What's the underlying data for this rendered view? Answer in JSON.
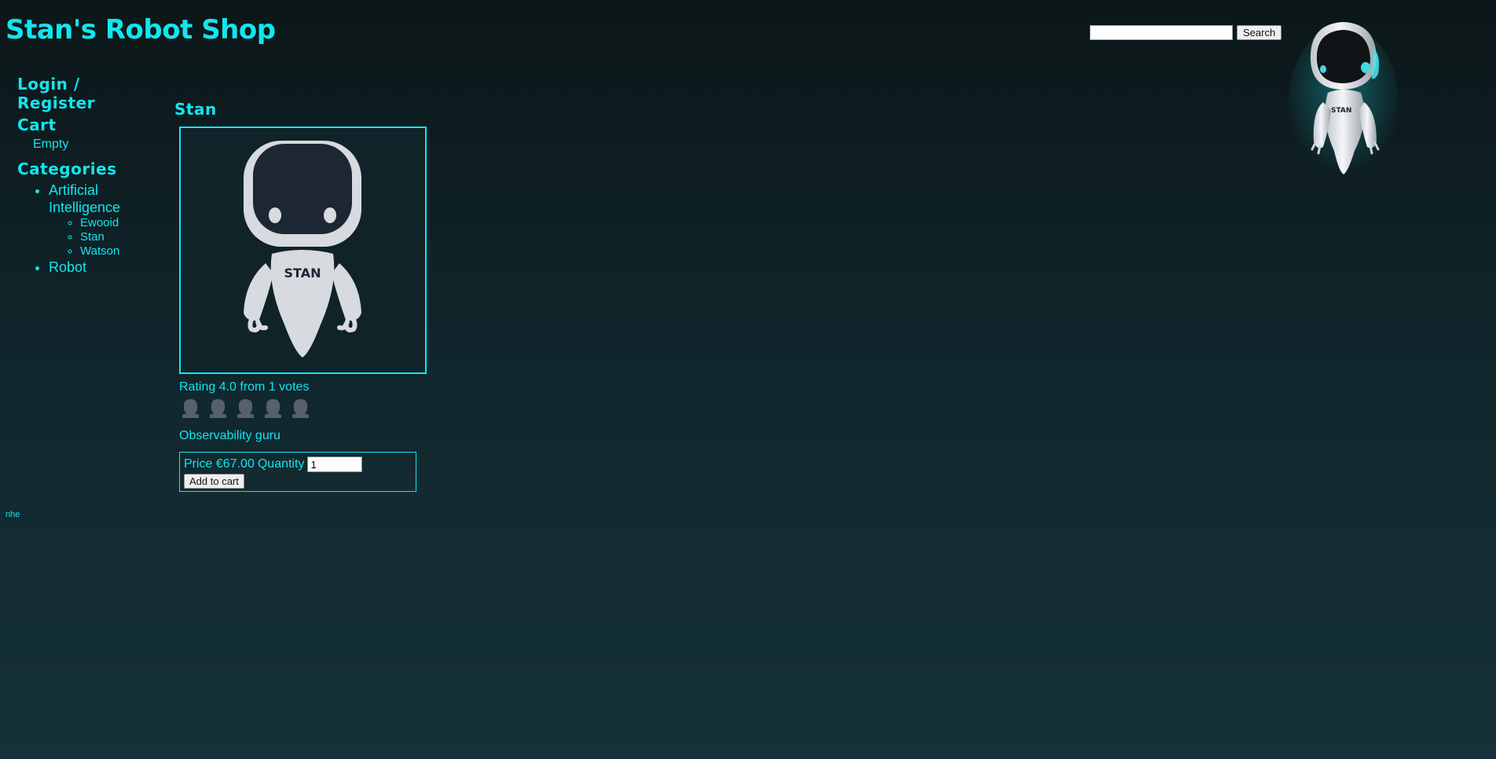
{
  "header": {
    "site_title": "Stan's Robot Shop",
    "search_placeholder": "",
    "search_button": "Search"
  },
  "sidebar": {
    "login_label": "Login / Register",
    "cart_label": "Cart",
    "cart_status": "Empty",
    "categories_label": "Categories",
    "categories": [
      {
        "label": "Artificial Intelligence",
        "items": [
          "Ewooid",
          "Stan",
          "Watson"
        ]
      },
      {
        "label": "Robot",
        "items": []
      }
    ]
  },
  "product": {
    "name": "Stan",
    "image_label": "STAN",
    "rating_text": "Rating 4.0 from 1 votes",
    "rating_value": 4.0,
    "rating_max": 5,
    "description": "Observability guru",
    "price_label": "Price €67.00",
    "quantity_label": "Quantity",
    "quantity_value": "1",
    "add_to_cart_label": "Add to cart"
  },
  "mascot_label": "STAN",
  "footer": {
    "text": "nhe"
  },
  "colors": {
    "accent": "#11e6ee",
    "background_top": "#0c1618",
    "background_bottom": "#163139"
  }
}
